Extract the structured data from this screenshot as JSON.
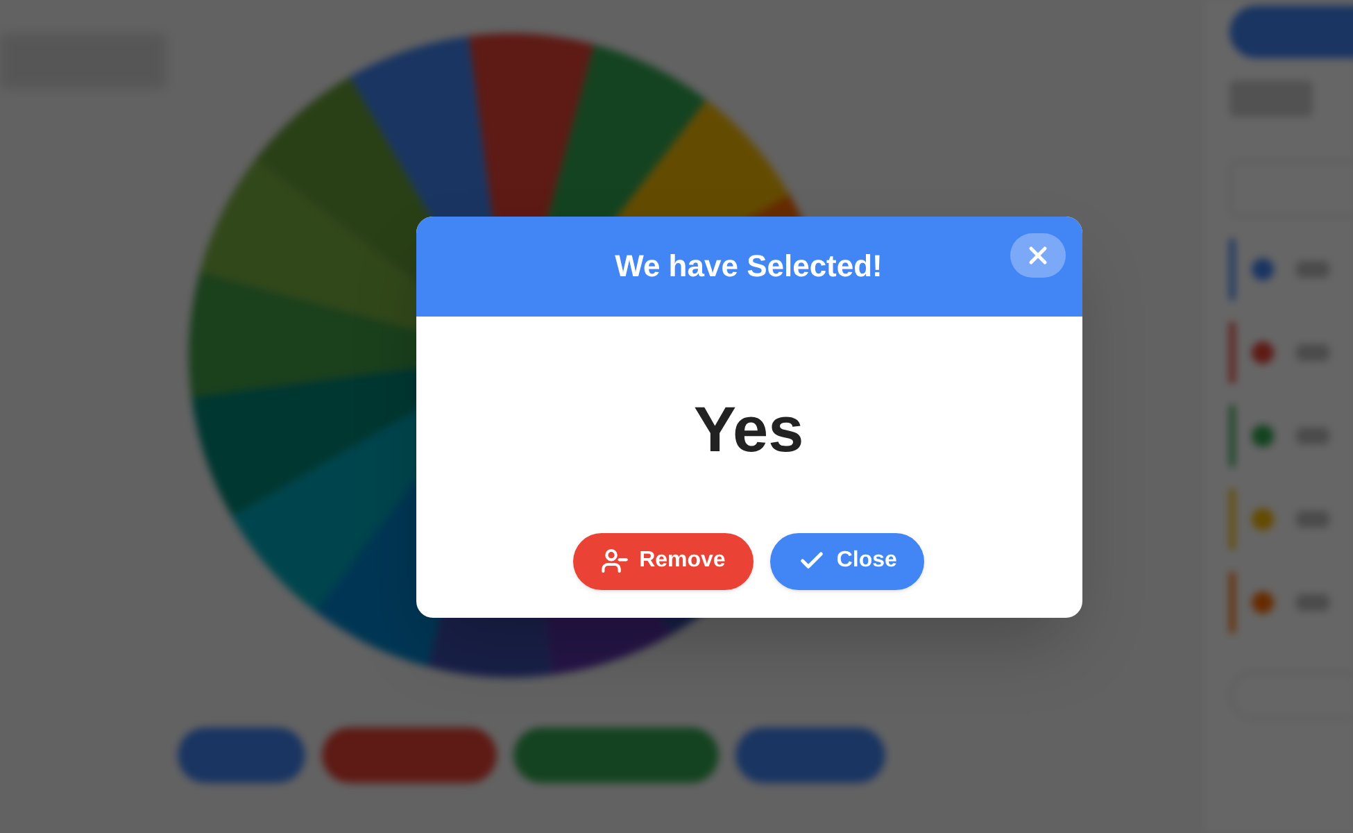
{
  "modal": {
    "title": "We have Selected!",
    "result": "Yes",
    "buttons": [
      {
        "label": "Remove",
        "kind": "remove"
      },
      {
        "label": "Close",
        "kind": "close"
      }
    ]
  }
}
